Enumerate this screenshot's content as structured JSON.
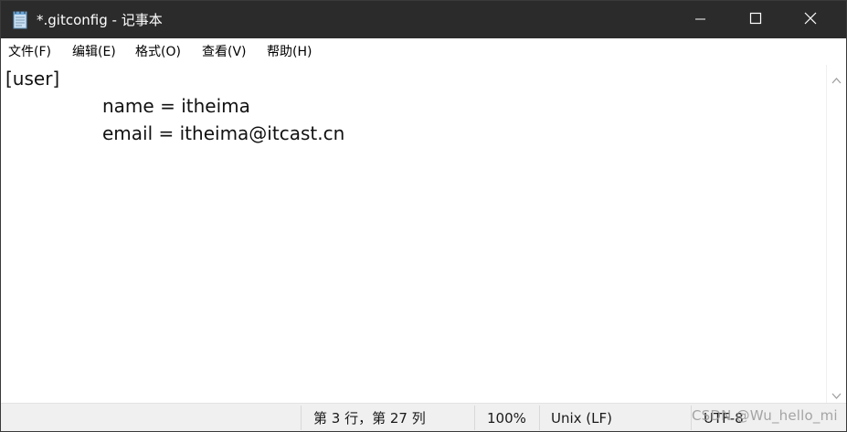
{
  "window": {
    "title": "*.gitconfig - 记事本",
    "icon": "notepad-icon",
    "controls": {
      "minimize": "minimize-icon",
      "maximize": "maximize-icon",
      "close": "close-icon"
    }
  },
  "menu": {
    "items": [
      {
        "label": "文件(F)"
      },
      {
        "label": "编辑(E)"
      },
      {
        "label": "格式(O)"
      },
      {
        "label": "查看(V)"
      },
      {
        "label": "帮助(H)"
      }
    ]
  },
  "editor": {
    "lines": [
      "[user]",
      "name = itheima",
      "email = itheima@itcast.cn"
    ]
  },
  "statusbar": {
    "position": "第 3 行，第 27 列",
    "zoom": "100%",
    "line_ending": "Unix (LF)",
    "encoding": "UTF-8"
  },
  "watermark": "CSDN @Wu_hello_mi",
  "colors": {
    "titlebar": "#2b2b2b",
    "statusbar": "#f0f0f0"
  }
}
